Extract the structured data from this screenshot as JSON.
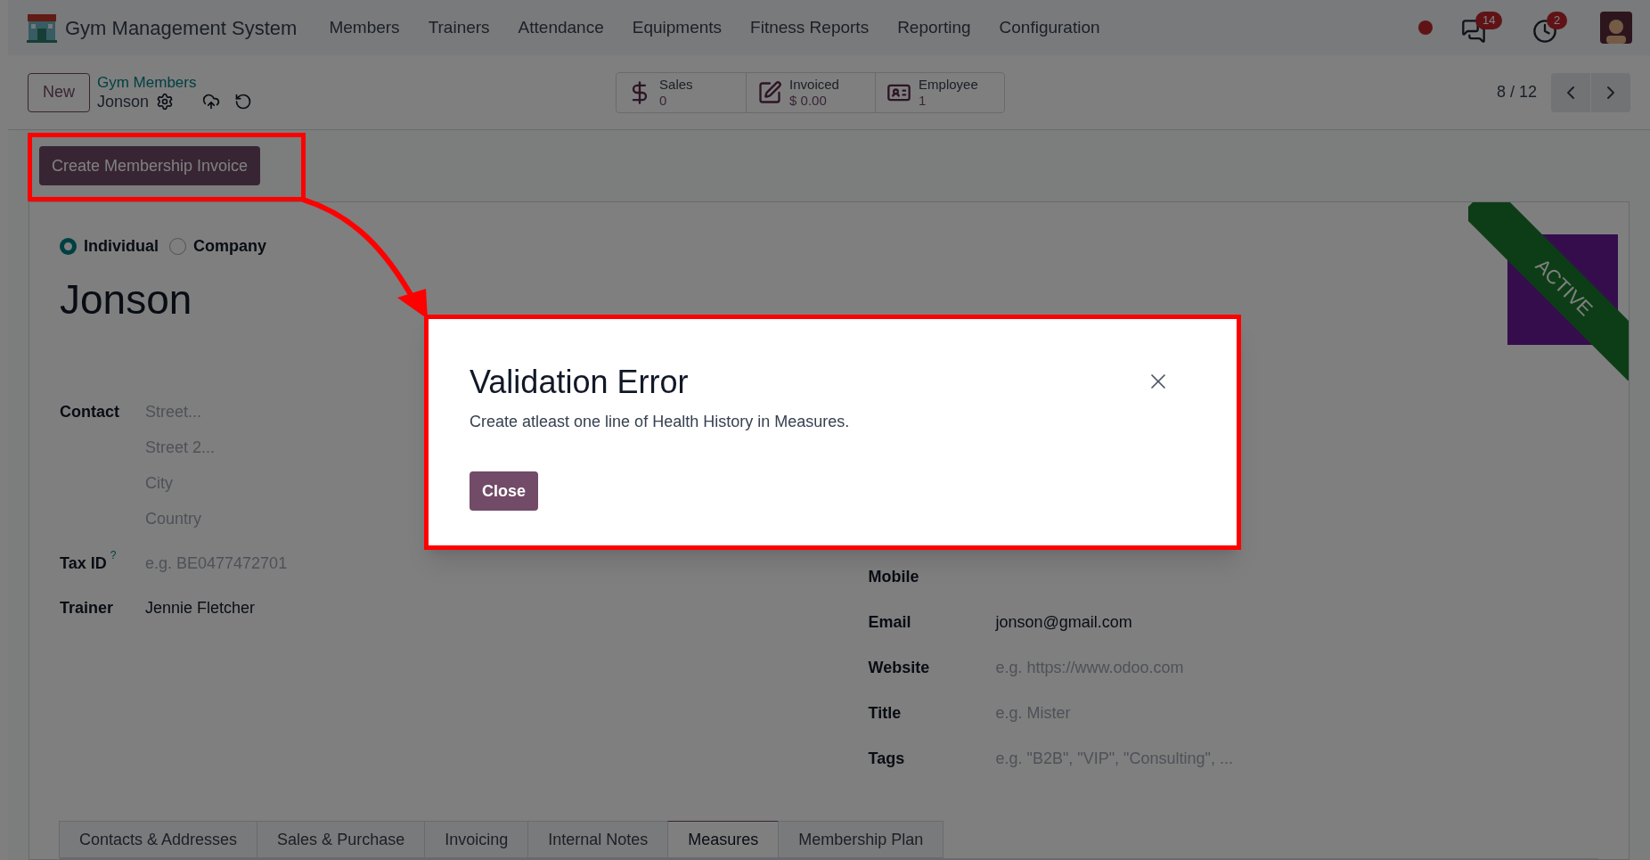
{
  "navbar": {
    "app_title": "Gym Management System",
    "menu": [
      "Members",
      "Trainers",
      "Attendance",
      "Equipments",
      "Fitness Reports",
      "Reporting",
      "Configuration"
    ],
    "chat_badge": "14",
    "activity_badge": "2"
  },
  "control_panel": {
    "new_button": "New",
    "breadcrumb": "Gym Members",
    "record": "Jonson",
    "stat_buttons": [
      {
        "kind": "sales",
        "label": "Sales",
        "value": "0"
      },
      {
        "kind": "invoiced",
        "label": "Invoiced",
        "value": "$ 0.00"
      },
      {
        "kind": "employee",
        "label": "Employee",
        "value": "1"
      }
    ],
    "pager": "8 / 12"
  },
  "action_button": "Create Membership Invoice",
  "form": {
    "partner_type": [
      {
        "label": "Individual",
        "selected": true
      },
      {
        "label": "Company",
        "selected": false
      }
    ],
    "name": "Jonson",
    "ribbon": "ACTIVE",
    "address": {
      "label": "Contact",
      "placeholders": [
        "Street...",
        "Street 2...",
        "City",
        "Country"
      ]
    },
    "left_fields": [
      {
        "label": "Tax ID",
        "help": "?",
        "placeholder": "e.g. BE0477472701"
      },
      {
        "label": "Trainer",
        "value": "Jennie Fletcher"
      }
    ],
    "right_fields": [
      {
        "label": "Mobile"
      },
      {
        "label": "Email",
        "value": "jonson@gmail.com"
      },
      {
        "label": "Website",
        "placeholder": "e.g. https://www.odoo.com"
      },
      {
        "label": "Title",
        "placeholder": "e.g. Mister"
      },
      {
        "label": "Tags",
        "placeholder": "e.g. \"B2B\", \"VIP\", \"Consulting\", ..."
      }
    ],
    "tabs": [
      {
        "label": "Contacts & Addresses",
        "selected": false
      },
      {
        "label": "Sales & Purchase",
        "selected": false
      },
      {
        "label": "Invoicing",
        "selected": false
      },
      {
        "label": "Internal Notes",
        "selected": false
      },
      {
        "label": "Measures",
        "selected": true
      },
      {
        "label": "Membership Plan",
        "selected": false
      }
    ]
  },
  "dialog": {
    "title": "Validation Error",
    "message": "Create atleast one line of Health History in Measures.",
    "close_button": "Close"
  }
}
